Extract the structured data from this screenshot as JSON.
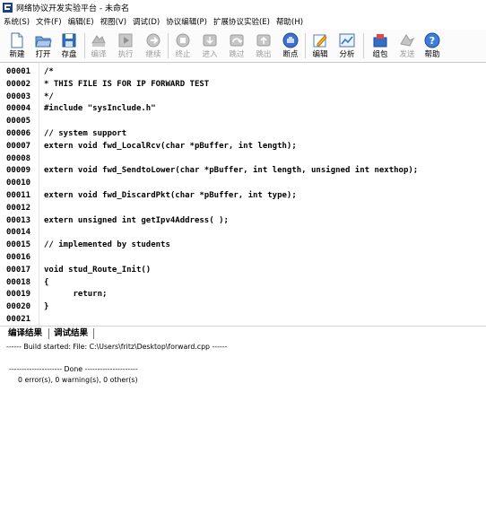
{
  "window": {
    "title": "网络协议开发实验平台 - 未命名"
  },
  "menu": [
    "系统(S)",
    "文件(F)",
    "编辑(E)",
    "视图(V)",
    "调试(D)",
    "协议编辑(P)",
    "扩展协议实验(E)",
    "帮助(H)"
  ],
  "toolbar": {
    "new": "新建",
    "open": "打开",
    "save": "存盘",
    "compile": "编译",
    "run": "执行",
    "continue": "继续",
    "stop": "终止",
    "step_into": "进入",
    "step_over": "跳过",
    "step_out": "跳出",
    "breakpoint": "断点",
    "edit": "编辑",
    "analyze": "分析",
    "packet": "组包",
    "send": "发送",
    "help": "帮助"
  },
  "code": [
    {
      "n": "00001",
      "t": "/*"
    },
    {
      "n": "00002",
      "t": "* THIS FILE IS FOR IP FORWARD TEST"
    },
    {
      "n": "00003",
      "t": "*/"
    },
    {
      "n": "00004",
      "t": "#include \"sysInclude.h\""
    },
    {
      "n": "00005",
      "t": ""
    },
    {
      "n": "00006",
      "t": "// system support"
    },
    {
      "n": "00007",
      "t": "extern void fwd_LocalRcv(char *pBuffer, int length);"
    },
    {
      "n": "00008",
      "t": ""
    },
    {
      "n": "00009",
      "t": "extern void fwd_SendtoLower(char *pBuffer, int length, unsigned int nexthop);"
    },
    {
      "n": "00010",
      "t": ""
    },
    {
      "n": "00011",
      "t": "extern void fwd_DiscardPkt(char *pBuffer, int type);"
    },
    {
      "n": "00012",
      "t": ""
    },
    {
      "n": "00013",
      "t": "extern unsigned int getIpv4Address( );"
    },
    {
      "n": "00014",
      "t": ""
    },
    {
      "n": "00015",
      "t": "// implemented by students"
    },
    {
      "n": "00016",
      "t": ""
    },
    {
      "n": "00017",
      "t": "void stud_Route_Init()"
    },
    {
      "n": "00018",
      "t": "{"
    },
    {
      "n": "00019",
      "t": "      return;"
    },
    {
      "n": "00020",
      "t": "}"
    },
    {
      "n": "00021",
      "t": ""
    }
  ],
  "tabs": {
    "compile_result": "编译结果",
    "debug_result": "调试结果"
  },
  "output": {
    "line1": "------ Build started: File: C:\\Users\\fritz\\Desktop\\forward.cpp ------",
    "line2": "--------------------- Done ---------------------",
    "line3": "0 error(s), 0 warning(s), 0 other(s)"
  }
}
